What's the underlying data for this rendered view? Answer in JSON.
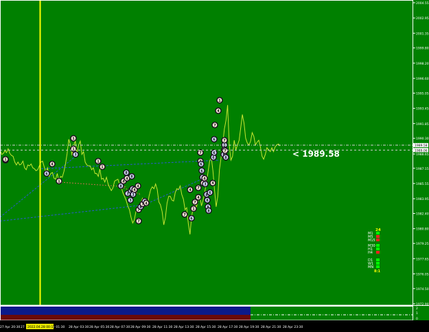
{
  "colors": {
    "background": "#008000",
    "price_line": "#c8e632",
    "cursor": "#ffff00",
    "frame": "#ffffff",
    "trend_line": "#2a5ad0",
    "level_line": "#c87050",
    "volume_bar": "#0b1a8a",
    "volume_bar_lower": "#6a0a0a",
    "highlight": "#e6e600",
    "marker_fill": "#f3e6d6",
    "marker_fill_alt": "#d8e2ff",
    "marker_stroke": "#1a0a20"
  },
  "price_label": "< 1989.58",
  "price_tags": {
    "ask": "1989.58",
    "bid": "1989.06"
  },
  "time_highlight": "2022.04.28 00:15",
  "timeframes": {
    "count": "24",
    "items": [
      "M1",
      "M5",
      "M15",
      "M30",
      "H1",
      "H4",
      "D1",
      "W1",
      "MN"
    ],
    "states": [
      "green",
      "red",
      "red",
      "green",
      "green",
      "red",
      "green",
      "green",
      "green"
    ],
    "ratio": "8:1"
  },
  "volume_scale": [
    "2",
    "1",
    "0"
  ],
  "chart_data": {
    "type": "line",
    "y_ticks": [
      "2004.55",
      "2002.95",
      "2001.35",
      "1999.80",
      "1998.20",
      "1996.60",
      "1995.05",
      "1993.45",
      "1991.85",
      "1990.30",
      "1988.65",
      "1987.15",
      "1985.55",
      "1983.95",
      "1982.40",
      "1980.80",
      "1979.25",
      "1977.65",
      "1976.05",
      "1974.50",
      "1972.90"
    ],
    "ylim": [
      1972.9,
      2004.55
    ],
    "x_ticks": [
      "27 Apr 20:30",
      "27",
      "",
      "28 Apr 01:30",
      "28 Apr 03:30",
      "28 Apr 05:30",
      "28 Apr 07:30",
      "28 Apr 09:30",
      "28 Apr 11:30",
      "28 Apr 13:30",
      "28 Apr 15:30",
      "28 Apr 17:30",
      "28 Apr 19:30",
      "28 Apr 21:30",
      "28 Apr 23:30"
    ],
    "series": [
      {
        "values": [
          1989.1,
          1988.6,
          1988.7,
          1989.0,
          1988.8,
          1989.2,
          1988.7,
          1988.5,
          1988.4,
          1987.8,
          1987.5,
          1987.8,
          1987.5,
          1987.6,
          1987.9,
          1987.2,
          1987.0,
          1987.5,
          1987.4,
          1987.6,
          1987.2,
          1987.1,
          1986.9,
          1987.0,
          1987.4,
          1987.8,
          1987.9,
          1987.3,
          1986.7,
          1987.2,
          1986.3,
          1986.6,
          1986.7,
          1986.1,
          1986.0,
          1986.6,
          1985.7,
          1986.3,
          1986.2,
          1986.8,
          1987.6,
          1988.7,
          1990.2,
          1989.6,
          1988.5,
          1989.6,
          1990.0,
          1988.7,
          1989.6,
          1990.0,
          1988.6,
          1988.9,
          1987.8,
          1987.5,
          1987.4,
          1987.4,
          1987.0,
          1987.2,
          1986.6,
          1986.6,
          1986.3,
          1987.1,
          1986.0,
          1986.1,
          1985.7,
          1986.2,
          1985.5,
          1985.1,
          1984.8,
          1985.1,
          1985.8,
          1985.9,
          1986.0,
          1985.4,
          1985.2,
          1984.6,
          1984.2,
          1983.8,
          1983.2,
          1982.8,
          1982.0,
          1981.4,
          1981.7,
          1982.6,
          1983.1,
          1982.7,
          1983.6,
          1984.0,
          1983.6,
          1983.4,
          1983.2,
          1984.2,
          1984.9,
          1985.2,
          1985.0,
          1985.5,
          1984.9,
          1983.6,
          1983.3,
          1982.6,
          1981.2,
          1982.0,
          1983.5,
          1984.2,
          1984.2,
          1983.8,
          1983.7,
          1984.6,
          1985.0,
          1984.9,
          1985.3,
          1984.4,
          1983.9,
          1982.8,
          1983.0,
          1981.3,
          1980.2,
          1982.1,
          1983.0,
          1983.4,
          1983.1,
          1983.8,
          1984.2,
          1983.2,
          1983.8,
          1984.6,
          1985.6,
          1986.7,
          1987.9,
          1988.3,
          1986.9,
          1984.8,
          1983.1,
          1984.2,
          1987.0,
          1988.3,
          1989.7,
          1991.3,
          1992.2,
          1993.8,
          1989.6,
          1988.0,
          1988.4,
          1990.1,
          1989.1,
          1989.6,
          1990.1,
          1991.4,
          1992.8,
          1991.9,
          1990.3,
          1989.8,
          1989.6,
          1990.0,
          1990.9,
          1990.5,
          1989.6,
          1989.9,
          1990.1,
          1989.4,
          1988.4,
          1988.1,
          1988.6,
          1989.3,
          1989.1,
          1988.9,
          1989.3,
          1988.9,
          1989.4,
          1989.6,
          1989.7,
          1989.5
        ]
      }
    ],
    "markers": [
      {
        "x": 8,
        "y": 1988.0,
        "n": 1
      },
      {
        "x": 8,
        "y": 1988.1,
        "n": 1
      },
      {
        "x": 68,
        "y": 1986.6,
        "n": 6
      },
      {
        "x": 76,
        "y": 1987.6,
        "n": 4
      },
      {
        "x": 86,
        "y": 1985.8,
        "n": 1
      },
      {
        "x": 107,
        "y": 1990.3,
        "n": 1
      },
      {
        "x": 107,
        "y": 1989.2,
        "n": 1
      },
      {
        "x": 110,
        "y": 1988.6,
        "n": 3
      },
      {
        "x": 143,
        "y": 1987.9,
        "n": 1
      },
      {
        "x": 149,
        "y": 1987.3,
        "n": 1
      },
      {
        "x": 176,
        "y": 1985.3,
        "n": 8
      },
      {
        "x": 180,
        "y": 1985.8,
        "n": 4
      },
      {
        "x": 184,
        "y": 1986.7,
        "n": 8
      },
      {
        "x": 185,
        "y": 1986.1,
        "n": 4
      },
      {
        "x": 186,
        "y": 1984.5,
        "n": 3
      },
      {
        "x": 190,
        "y": 1983.8,
        "n": 3
      },
      {
        "x": 191,
        "y": 1984.8,
        "n": 8
      },
      {
        "x": 192,
        "y": 1986.3,
        "n": 8
      },
      {
        "x": 193,
        "y": 1985.0,
        "n": 8
      },
      {
        "x": 194,
        "y": 1984.4,
        "n": 3
      },
      {
        "x": 196,
        "y": 1984.9,
        "n": 4
      },
      {
        "x": 201,
        "y": 1985.3,
        "n": 4
      },
      {
        "x": 202,
        "y": 1982.8,
        "n": 7
      },
      {
        "x": 202,
        "y": 1981.6,
        "n": 7
      },
      {
        "x": 205,
        "y": 1983.1,
        "n": 6
      },
      {
        "x": 208,
        "y": 1983.4,
        "n": 7
      },
      {
        "x": 211,
        "y": 1983.7,
        "n": 6
      },
      {
        "x": 213,
        "y": 1983.5,
        "n": 4
      },
      {
        "x": 269,
        "y": 1982.3,
        "n": 7
      },
      {
        "x": 277,
        "y": 1984.9,
        "n": 4
      },
      {
        "x": 279,
        "y": 1981.9,
        "n": 6
      },
      {
        "x": 282,
        "y": 1982.9,
        "n": 1
      },
      {
        "x": 284,
        "y": 1983.6,
        "n": 7
      },
      {
        "x": 289,
        "y": 1984.1,
        "n": 4
      },
      {
        "x": 289,
        "y": 1985.1,
        "n": 7
      },
      {
        "x": 292,
        "y": 1988.8,
        "n": 7
      },
      {
        "x": 292,
        "y": 1987.9,
        "n": 1
      },
      {
        "x": 293,
        "y": 1987.6,
        "n": 6
      },
      {
        "x": 294,
        "y": 1986.9,
        "n": 6
      },
      {
        "x": 295,
        "y": 1986.2,
        "n": 3
      },
      {
        "x": 296,
        "y": 1985.6,
        "n": 4
      },
      {
        "x": 298,
        "y": 1986.1,
        "n": 4
      },
      {
        "x": 299,
        "y": 1985.5,
        "n": 3
      },
      {
        "x": 301,
        "y": 1984.4,
        "n": 8
      },
      {
        "x": 302,
        "y": 1983.8,
        "n": 8
      },
      {
        "x": 303,
        "y": 1983.1,
        "n": 8
      },
      {
        "x": 304,
        "y": 1982.7,
        "n": 8
      },
      {
        "x": 306,
        "y": 1984.6,
        "n": 6
      },
      {
        "x": 310,
        "y": 1985.6,
        "n": 4
      },
      {
        "x": 311,
        "y": 1988.3,
        "n": 6
      },
      {
        "x": 312,
        "y": 1988.8,
        "n": 6
      },
      {
        "x": 312,
        "y": 1990.2,
        "n": 6
      },
      {
        "x": 313,
        "y": 1991.7,
        "n": 7
      },
      {
        "x": 318,
        "y": 1993.2,
        "n": 4
      },
      {
        "x": 320,
        "y": 1994.3,
        "n": 1
      },
      {
        "x": 326,
        "y": 1988.6,
        "n": 8
      },
      {
        "x": 327,
        "y": 1989.6,
        "n": 8
      },
      {
        "x": 327,
        "y": 1990.1,
        "n": 7
      },
      {
        "x": 327,
        "y": 1989.1,
        "n": 8
      },
      {
        "x": 328,
        "y": 1989.0,
        "n": 7
      },
      {
        "x": 329,
        "y": 1988.3,
        "n": 8
      }
    ]
  }
}
